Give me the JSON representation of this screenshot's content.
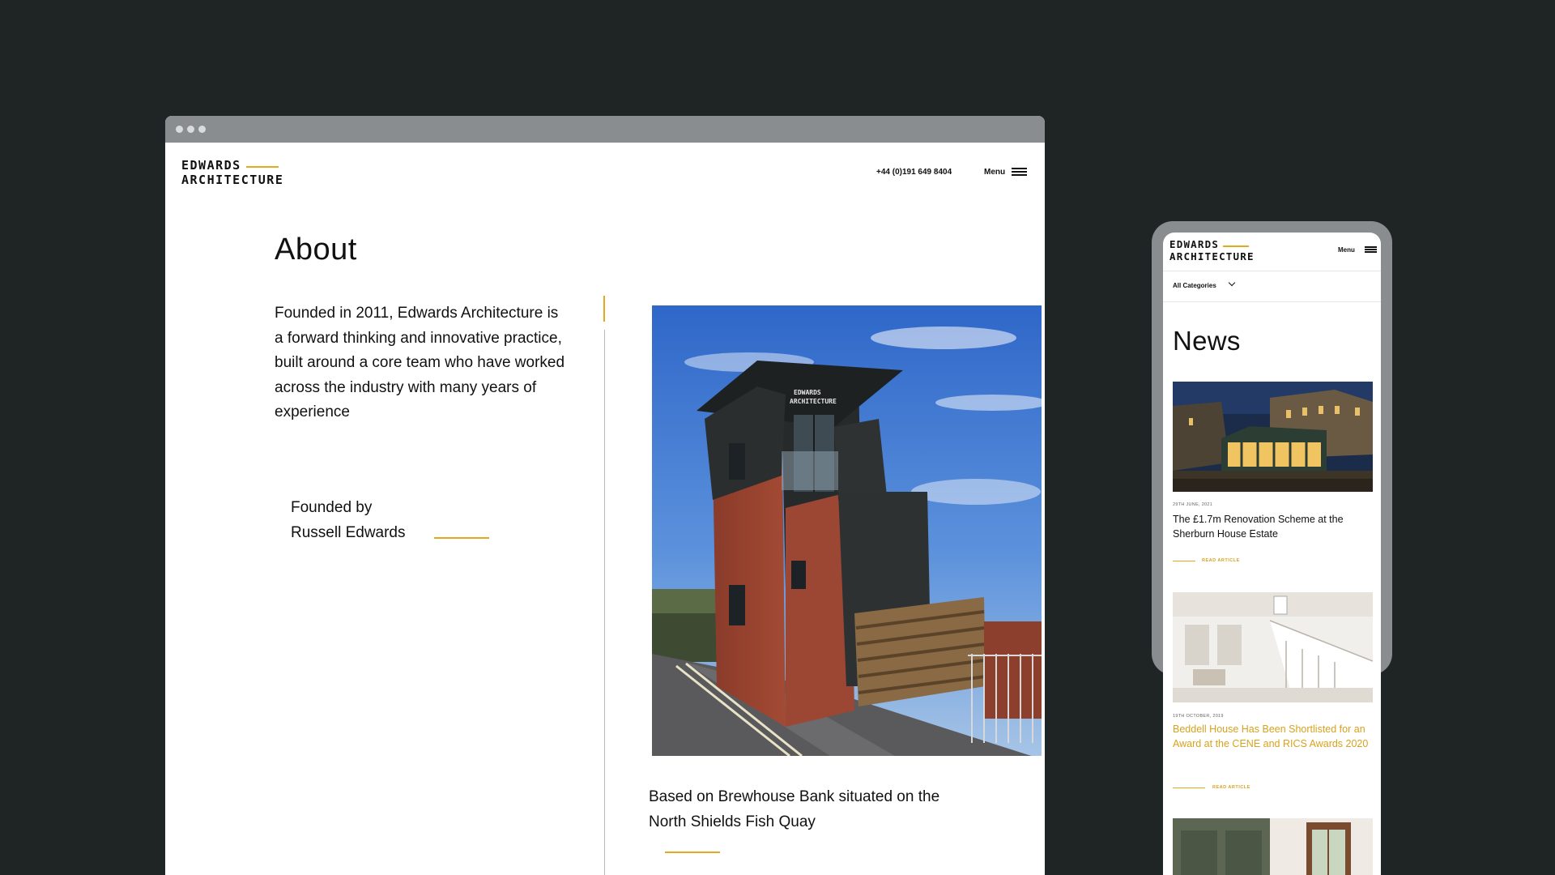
{
  "desktop": {
    "logo": {
      "line1": "EDWARDS",
      "line2": "ARCHITECTURE"
    },
    "header": {
      "phone": "+44 (0)191 649 8404",
      "menu_label": "Menu"
    },
    "about": {
      "title": "About",
      "intro": "Founded in 2011, Edwards Architecture is a forward thinking and innovative practice, built around a core team who have worked across the industry with many years of experience",
      "founded_line1": "Founded by",
      "founded_line2": "Russell Edwards",
      "photo_sign": "EDWARDS ARCHITECTURE",
      "based": "Based on Brewhouse Bank situated on the North Shields Fish Quay"
    }
  },
  "mobile": {
    "logo": {
      "line1": "EDWARDS",
      "line2": "ARCHITECTURE"
    },
    "menu_label": "Menu",
    "filter_label": "All Categories",
    "title": "News",
    "articles": [
      {
        "date": "29TH JUNE, 2021",
        "title": "The £1.7m Renovation Scheme at the Sherburn House Estate",
        "read": "READ ARTICLE"
      },
      {
        "date": "19TH OCTOBER, 2019",
        "title": "Beddell House Has Been Shortlisted for an Award at the CENE and RICS Awards 2020",
        "read": "READ ARTICLE"
      }
    ]
  },
  "colors": {
    "background": "#1f2424",
    "accent": "#e5a921",
    "frame": "#8a8d8f"
  },
  "icons": [
    "hamburger-menu-icon",
    "chevron-down-icon"
  ]
}
